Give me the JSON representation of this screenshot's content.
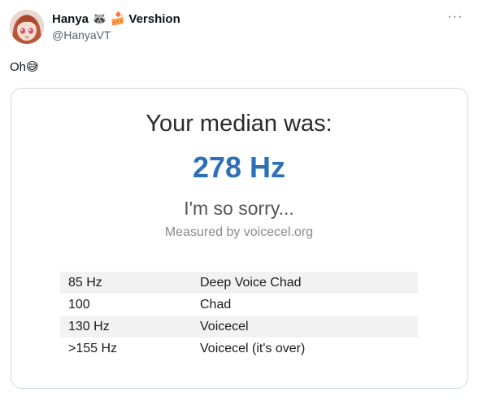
{
  "tweet": {
    "author": {
      "display_name": "Hanya",
      "name_suffix": "Vershion",
      "name_emoji_1": "🦝",
      "name_emoji_2": "🍰",
      "handle": "@HanyaVT"
    },
    "more_label": "···",
    "text": "Oh",
    "text_emoji": "😅"
  },
  "card": {
    "heading": "Your median was:",
    "median_value": "278 Hz",
    "message": "I'm so sorry...",
    "source": "Measured by voicecel.org",
    "table": {
      "rows": [
        {
          "frequency": "85 Hz",
          "category": "Deep Voice Chad"
        },
        {
          "frequency": "100",
          "category": "Chad"
        },
        {
          "frequency": "130 Hz",
          "category": "Voicecel"
        },
        {
          "frequency": ">155 Hz",
          "category": "Voicecel (it's over)"
        }
      ]
    }
  },
  "colors": {
    "median": "#2f6fb8",
    "handle": "#536471",
    "card_border": "#cfd9de"
  }
}
